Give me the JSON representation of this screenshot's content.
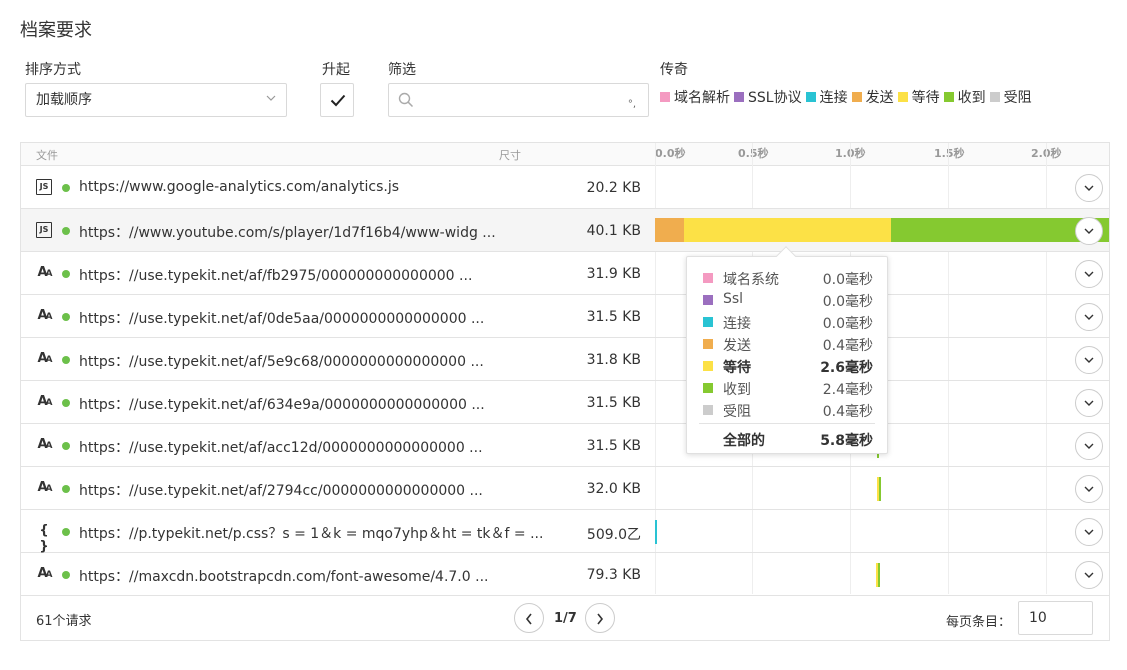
{
  "title": "档案要求",
  "controls": {
    "sort_label": "排序方式",
    "sort_value": "加载顺序",
    "asc_label": "升起",
    "filter_label": "筛选",
    "filter_placeholder": "",
    "legend_label": "传奇"
  },
  "legend": [
    {
      "label": "域名解析",
      "color": "#f49ac1"
    },
    {
      "label": "SSL协议",
      "color": "#9b6fbf"
    },
    {
      "label": "连接",
      "color": "#29c3d3"
    },
    {
      "label": "发送",
      "color": "#f0ad4e"
    },
    {
      "label": "等待",
      "color": "#fce146"
    },
    {
      "label": "收到",
      "color": "#85c930"
    },
    {
      "label": "受阻",
      "color": "#cccccc"
    }
  ],
  "table": {
    "col_file": "文件",
    "col_size": "尺寸",
    "ticks": [
      "0.0秒",
      "0.5秒",
      "1.0秒",
      "1.5秒",
      "2.0秒"
    ],
    "rows": [
      {
        "icon": "JS",
        "icon_name": "js-file-icon",
        "url": "https://www.google-analytics.com/analytics.js",
        "size": "20.2 KB"
      },
      {
        "icon": "JS",
        "icon_name": "js-file-icon",
        "url": "https：//www.youtube.com/s/player/1d7f16b4/www-widg ...",
        "size": "40.1 KB"
      },
      {
        "icon": "AA",
        "icon_name": "font-file-icon",
        "url": "https：//use.typekit.net/af/fb2975/000000000000000 ...",
        "size": "31.9 KB"
      },
      {
        "icon": "AA",
        "icon_name": "font-file-icon",
        "url": "https：//use.typekit.net/af/0de5aa/0000000000000000 ...",
        "size": "31.5 KB"
      },
      {
        "icon": "AA",
        "icon_name": "font-file-icon",
        "url": "https：//use.typekit.net/af/5e9c68/0000000000000000 ...",
        "size": "31.8 KB"
      },
      {
        "icon": "AA",
        "icon_name": "font-file-icon",
        "url": "https：//use.typekit.net/af/634e9a/0000000000000000 ...",
        "size": "31.5 KB"
      },
      {
        "icon": "AA",
        "icon_name": "font-file-icon",
        "url": "https：//use.typekit.net/af/acc12d/0000000000000000 ...",
        "size": "31.5 KB"
      },
      {
        "icon": "AA",
        "icon_name": "font-file-icon",
        "url": "https：//use.typekit.net/af/2794cc/0000000000000000 ...",
        "size": "32.0 KB"
      },
      {
        "icon": "{ }",
        "icon_name": "css-file-icon",
        "url": "https：//p.typekit.net/p.css？s = 1＆k = mqo7yhp＆ht = tk＆f = ...",
        "size": "509.0乙"
      },
      {
        "icon": "AA",
        "icon_name": "font-file-icon",
        "url": "https：//maxcdn.bootstrapcdn.com/font-awesome/4.7.0 ...",
        "size": "79.3 KB"
      }
    ]
  },
  "tooltip": {
    "rows": [
      {
        "label": "域名系统",
        "value": "0.0毫秒",
        "color": "#f49ac1"
      },
      {
        "label": "Ssl",
        "value": "0.0毫秒",
        "color": "#9b6fbf"
      },
      {
        "label": "连接",
        "value": "0.0毫秒",
        "color": "#29c3d3"
      },
      {
        "label": "发送",
        "value": "0.4毫秒",
        "color": "#f0ad4e"
      },
      {
        "label": "等待",
        "value": "2.6毫秒",
        "color": "#fce146"
      },
      {
        "label": "收到",
        "value": "2.4毫秒",
        "color": "#85c930"
      },
      {
        "label": "受阻",
        "value": "0.4毫秒",
        "color": "#cccccc"
      }
    ],
    "total_label": "全部的",
    "total_value": "5.8毫秒"
  },
  "footer": {
    "count": "61个请求",
    "page": "1/7",
    "per_page_label": "每页条目：",
    "per_page_value": "10"
  }
}
